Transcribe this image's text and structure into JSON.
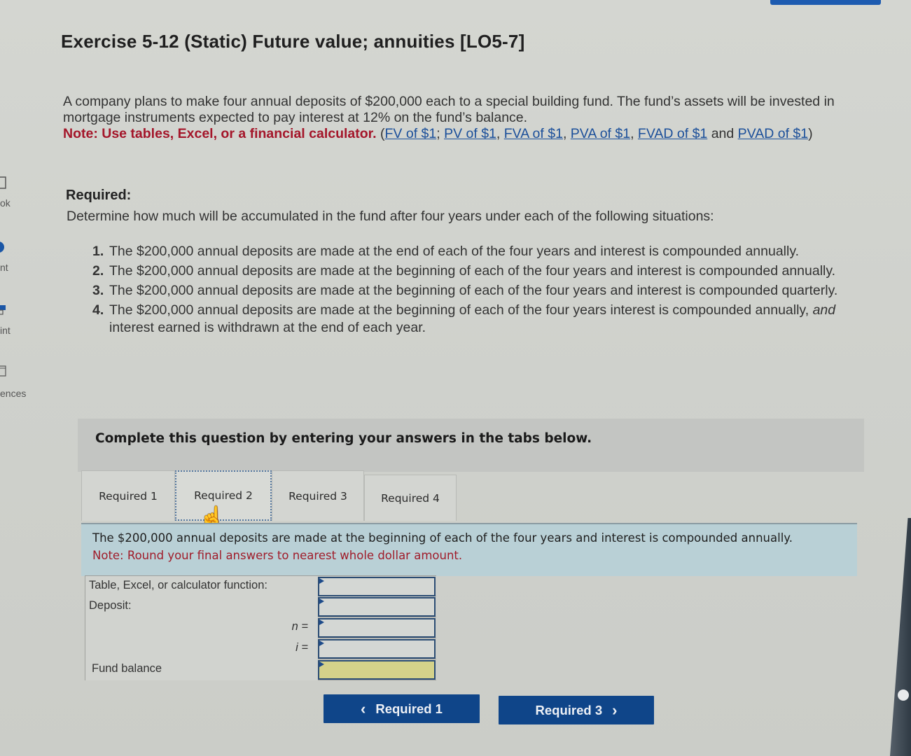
{
  "exercise": {
    "title": "Exercise 5-12 (Static) Future value; annuities [LO5-7]",
    "intro_text": "A company plans to make four annual deposits of $200,000 each to a special building fund. The fund’s assets will be invested in mortgage instruments expected to pay interest at 12% on the fund’s balance.",
    "note_text": "Note: Use tables, Excel, or a financial calculator.",
    "links_open": " (",
    "links": [
      {
        "label": "FV of $1",
        "sep": "; "
      },
      {
        "label": "PV of $1",
        "sep": ", "
      },
      {
        "label": "FVA of $1",
        "sep": ", "
      },
      {
        "label": "PVA of $1",
        "sep": ", "
      },
      {
        "label": "FVAD of $1",
        "sep": " and "
      },
      {
        "label": "PVAD of $1",
        "sep": ")"
      }
    ]
  },
  "sidebar": {
    "items": [
      {
        "label": "ok",
        "icon": "book-icon"
      },
      {
        "label": "nt",
        "icon": "hint-icon"
      },
      {
        "label": "int",
        "icon": "print-icon"
      },
      {
        "label": "ences",
        "icon": "references-icon"
      }
    ]
  },
  "required": {
    "heading": "Required:",
    "description": "Determine how much will be accumulated in the fund after four years under each of the following situations:",
    "items": [
      {
        "num": "1.",
        "text": "The $200,000 annual deposits are made at the end of each of the four years and interest is compounded annually."
      },
      {
        "num": "2.",
        "text": "The $200,000 annual deposits are made at the beginning of each of the four years and interest is compounded annually."
      },
      {
        "num": "3.",
        "text": "The $200,000 annual deposits are made at the beginning of each of the four years and interest is compounded quarterly."
      },
      {
        "num": "4.",
        "text_before": "The $200,000 annual deposits are made at the beginning of each of the four years interest is compounded annually, ",
        "text_em": "and",
        "text_after": " interest earned is withdrawn at the end of each year."
      }
    ]
  },
  "instructions": "Complete this question by entering your answers in the tabs below.",
  "tabs": [
    {
      "label": "Required 1",
      "active": false
    },
    {
      "label": "Required 2",
      "active": true
    },
    {
      "label": "Required 3",
      "active": false
    },
    {
      "label": "Required 4",
      "active": false
    }
  ],
  "panel": {
    "description": "The $200,000 annual deposits are made at the beginning of each of the four years and interest is compounded annually.",
    "note": "Note: Round your final answers to nearest whole dollar amount."
  },
  "answer_table": {
    "rows": [
      {
        "label": "Table, Excel, or calculator function:",
        "value": ""
      },
      {
        "label": "Deposit:",
        "value": ""
      },
      {
        "label": "n =",
        "value": ""
      },
      {
        "label": "i =",
        "value": ""
      },
      {
        "label": "Fund balance",
        "value": ""
      }
    ]
  },
  "nav": {
    "prev_label": "Required 1",
    "next_label": "Required 3",
    "prev_icon": "‹",
    "next_icon": "›"
  },
  "colors": {
    "accent": "#0f4589",
    "note_red": "#a4162a",
    "link_blue": "#1b4f9a",
    "total_field": "#d4d28a"
  }
}
